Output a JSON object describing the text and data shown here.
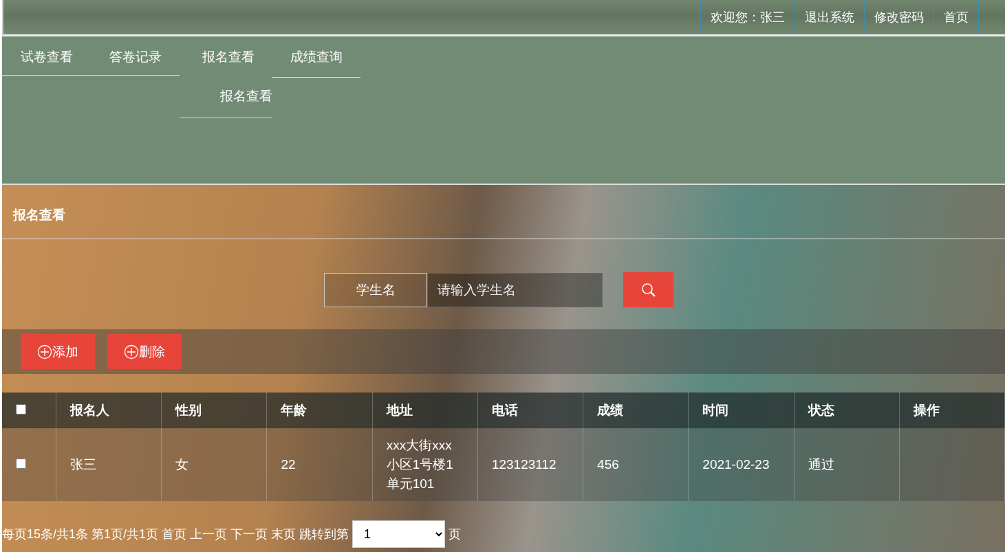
{
  "header": {
    "links": [
      {
        "label": "欢迎您：张三"
      },
      {
        "label": "退出系统"
      },
      {
        "label": "修改密码"
      },
      {
        "label": "首页"
      }
    ]
  },
  "nav": [
    {
      "label": "试卷查看",
      "expanded": false
    },
    {
      "label": "答卷记录",
      "expanded": false
    },
    {
      "label": "报名查看",
      "expanded": true,
      "children": [
        {
          "label": "报名查看"
        }
      ]
    },
    {
      "label": "成绩查询",
      "expanded": false
    }
  ],
  "page_title": "报名查看",
  "search": {
    "label": "学生名",
    "placeholder": "请输入学生名"
  },
  "toolbar": [
    {
      "label": "添加"
    },
    {
      "label": "删除"
    }
  ],
  "table": {
    "select_all": {
      "checked": false
    },
    "columns": [
      "报名人",
      "性别",
      "年龄",
      "地址",
      "电话",
      "成绩",
      "时间",
      "状态",
      "操作"
    ],
    "rows": [
      {
        "checked": false,
        "cells": [
          "张三",
          "女",
          "22",
          "xxx大街xxx小区1号楼1单元101",
          "123123112",
          "456",
          "2021-02-23",
          "通过",
          ""
        ]
      }
    ]
  },
  "pagination": {
    "info": "每页15条/共1条 第1页/共1页",
    "links": [
      "首页",
      "上一页",
      "下一页",
      "末页"
    ],
    "jump_label": "跳转到第",
    "page": "1",
    "suffix": "页"
  }
}
